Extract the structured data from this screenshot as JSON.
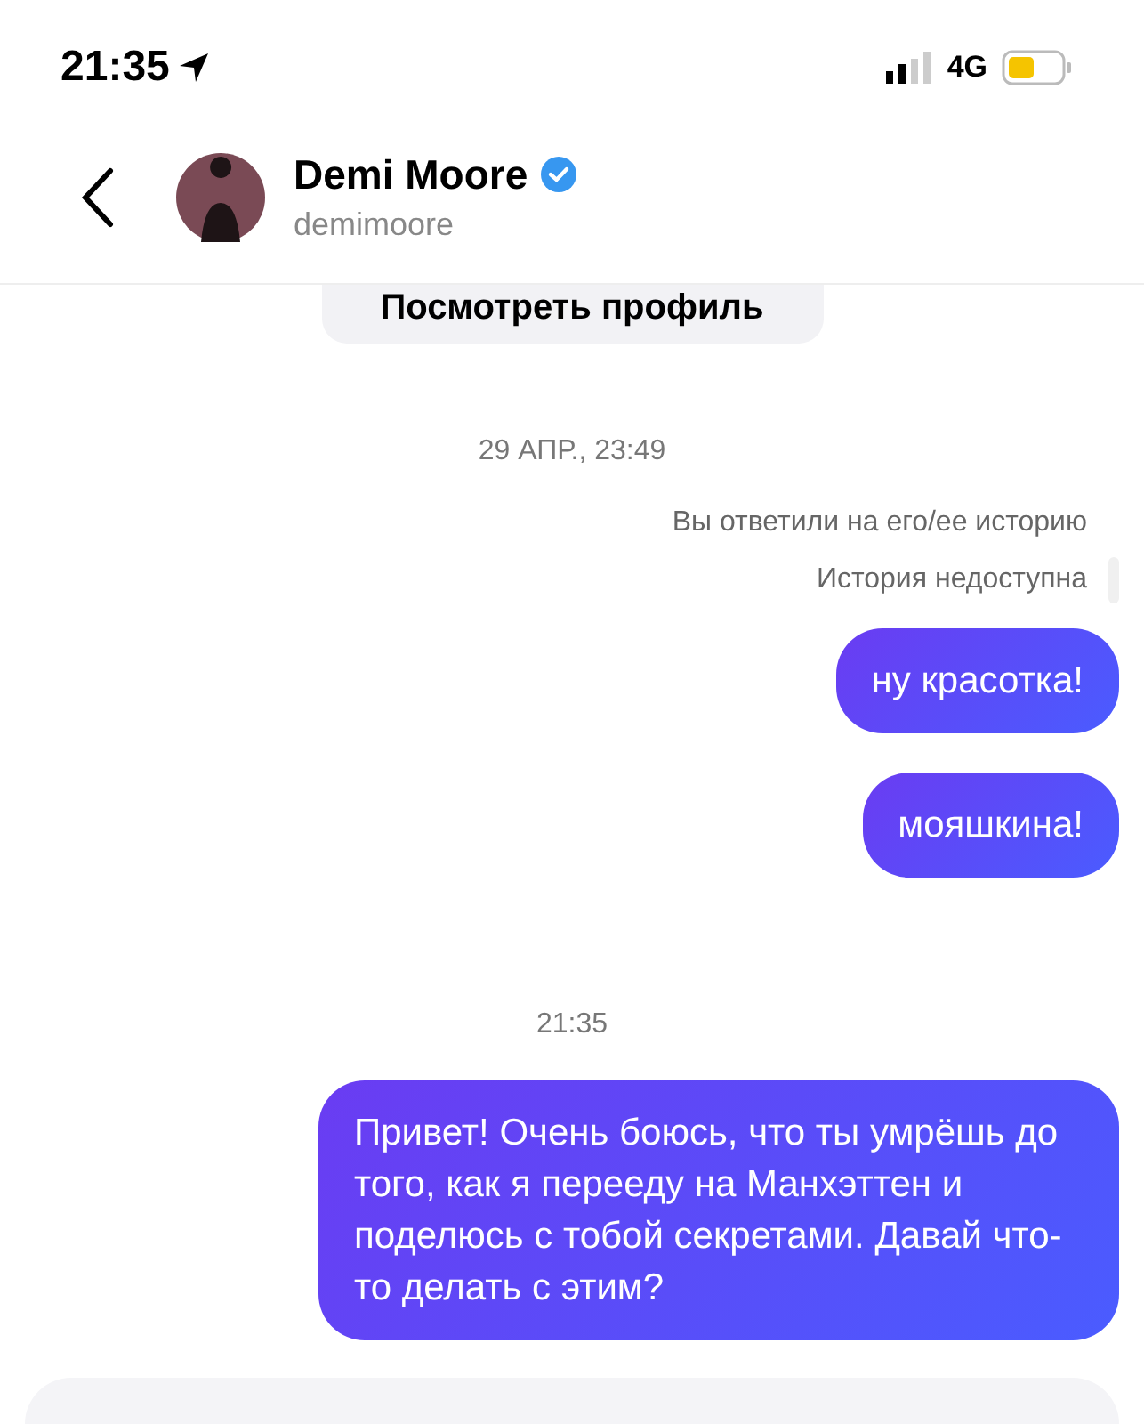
{
  "status_bar": {
    "time": "21:35",
    "network": "4G"
  },
  "header": {
    "name": "Demi Moore",
    "verified": true,
    "username": "demimoore"
  },
  "profile_button": {
    "label": "Посмотреть профиль"
  },
  "messages": [
    {
      "kind": "timestamp",
      "text": "29 АПР., 23:49"
    },
    {
      "kind": "note",
      "text": "Вы ответили на его/ее историю"
    },
    {
      "kind": "story",
      "text": "История недоступна"
    },
    {
      "kind": "sent",
      "text": "ну красотка!"
    },
    {
      "kind": "sent",
      "text": "мояшкина!"
    },
    {
      "kind": "timestamp",
      "text": "21:35"
    },
    {
      "kind": "sent",
      "text": "Привет! Очень боюсь, что ты умрёшь до того, как я перееду на Манхэттен и поделюсь с тобой секретами. Давай что-то делать с этим?"
    }
  ]
}
